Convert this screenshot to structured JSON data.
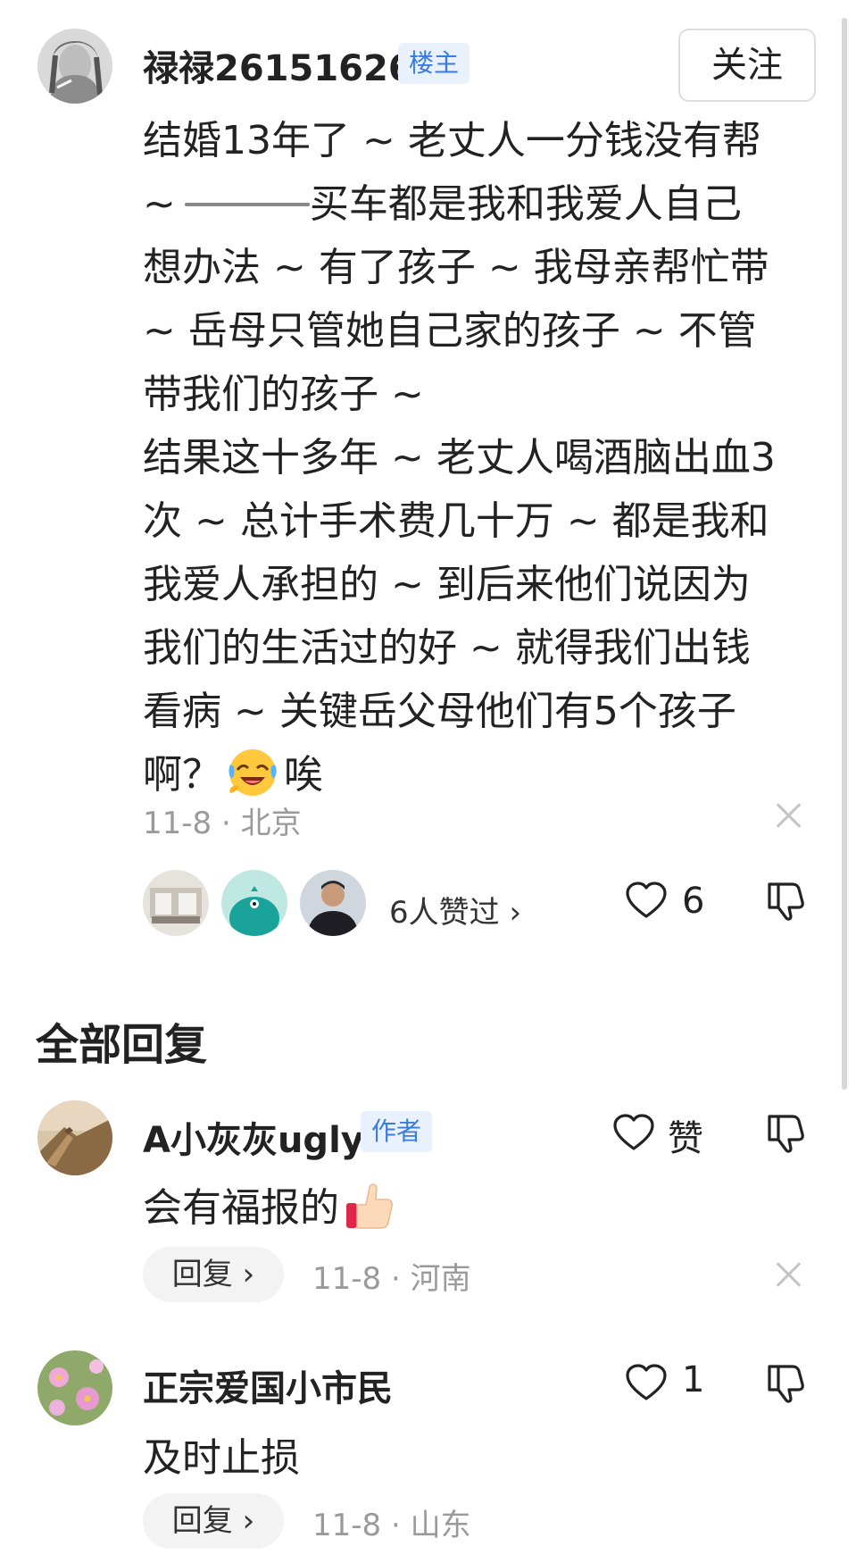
{
  "post": {
    "author": "禄禄26151626",
    "author_badge": "楼主",
    "follow_label": "关注",
    "body_lines": [
      "结婚13年了 ~ 老丈人一分钱没有帮",
      "买车都是我和我爱人自己",
      "想办法 ~ 有了孩子 ~ 我母亲帮忙带",
      " ~ 岳母只管她自己家的孩子 ~ 不管",
      "带我们的孩子 ~",
      "结果这十多年 ~ 老丈人喝酒脑出血3",
      "次 ~ 总计手术费几十万 ~ 都是我和",
      "我爱人承担的 ~ 到后来他们说因为",
      "我们的生活过的好 ~ 就得我们出钱",
      "看病 ~ 关键岳父母他们有5个孩子",
      "啊？",
      "唉"
    ],
    "line2_prefix": " ~",
    "emoji_name": "laughing-crying-face",
    "meta": "11-8 · 北京",
    "likes_text": "6人赞过 ›",
    "like_count": "6"
  },
  "replies_section_title": "全部回复",
  "replies": [
    {
      "author": "A小灰灰ugly",
      "badge": "作者",
      "text": "会有福报的",
      "emoji_name": "thumbs-up",
      "like_label": "赞",
      "reply_label": "回复 ›",
      "meta": "11-8 · 河南"
    },
    {
      "author": "正宗爱国小市民",
      "text": "及时止损",
      "like_label": "1",
      "reply_label": "回复 ›",
      "meta": "11-8 · 山东"
    }
  ],
  "colors": {
    "badge_bg": "#e9f1fd",
    "badge_text": "#3a7be0",
    "meta_text": "#9a9a9a"
  }
}
